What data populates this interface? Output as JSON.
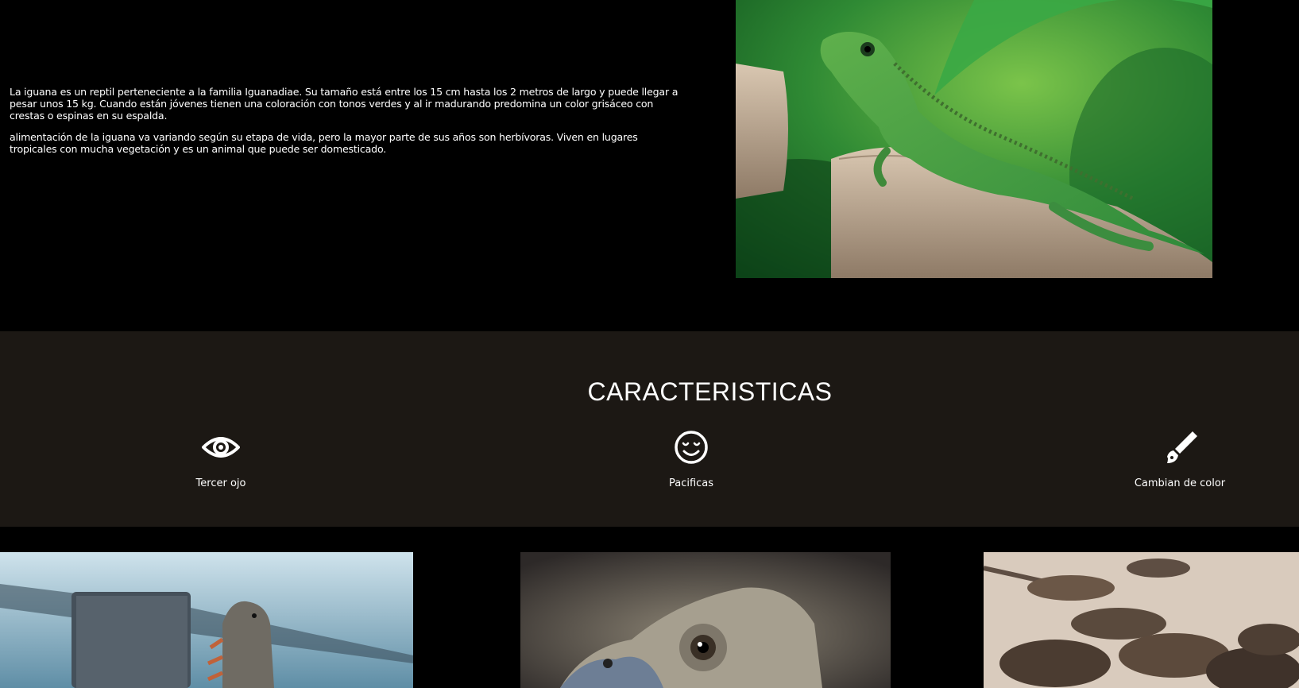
{
  "intro": {
    "paragraph_1": "La iguana es un reptil perteneciente a la familia Iguanadiae. Su tamaño está entre los 15 cm hasta los 2 metros de largo y puede llegar a pesar unos 15 kg. Cuando están jóvenes tienen una coloración con tonos verdes y al ir madurando predomina un color grisáceo con crestas o espinas en su espalda.",
    "paragraph_2": "alimentación de la iguana va variando según su etapa de vida, pero la mayor parte de sus años son herbívoras. Viven en lugares tropicales con mucha vegetación y es un animal que puede ser domesticado."
  },
  "features": {
    "title": "CARACTERISTICAS",
    "items": [
      {
        "label": "Tercer ojo",
        "icon": "eye-icon"
      },
      {
        "label": "Pacificas",
        "icon": "smile-icon"
      },
      {
        "label": "Cambian de color",
        "icon": "paint-brush-icon"
      }
    ]
  },
  "colors": {
    "page_background": "#000000",
    "features_background": "#1c1814",
    "text": "#ffffff"
  }
}
